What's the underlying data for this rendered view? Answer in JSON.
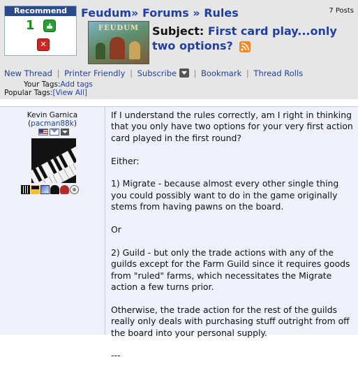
{
  "recommend": {
    "title": "Recommend",
    "count": "1",
    "thumbs_up_icon": "thumbs-up-icon",
    "thumbs_down_icon": "thumbs-down-icon",
    "thumbs_down_glyph": "✕"
  },
  "post_count": "7 Posts",
  "breadcrumb": {
    "game": "Feudum",
    "sep": "»",
    "forums": "Forums",
    "rules": "Rules"
  },
  "boxart_logo": "FEUDUM",
  "subject": {
    "label": "Subject:",
    "title": "First card play...only two options?"
  },
  "nav": {
    "new_thread": "New Thread",
    "printer_friendly": "Printer Friendly",
    "subscribe": "Subscribe",
    "bookmark": "Bookmark",
    "thread_rolls": "Thread Rolls",
    "sep": "|"
  },
  "tags": {
    "your_label": "Your Tags:",
    "your_link": "Add tags",
    "popular_label": "Popular Tags:",
    "popular_link": "[View All]"
  },
  "author": {
    "name": "Kevin Garnica",
    "handle_open": "(",
    "handle": "pacman88k",
    "handle_close": ")"
  },
  "post_body": [
    "If I understand the rules correctly, am I right in thinking that you only have two options for your very first action card played in the first round?",
    "Either:",
    "1) Migrate - because almost every other single thing you could possibly want to do in the game originally stems from having pawns on the board.",
    "Or",
    "2) Guild - but only the trade actions with any of the guilds except for the Farm Guild since it requires goods from \"ruled\" farms, which necessitates the Migrate action a few turns prior.",
    "Otherwise, the trade action for the rest of the guilds really only deals with purchasing stuff outright from off the board into your personal supply.",
    "---"
  ],
  "colors": {
    "link": "#1f3fa6",
    "recommend_header": "#2b4a8c",
    "post_bg": "#eef1f9",
    "header_bg": "#e6e6e6"
  }
}
